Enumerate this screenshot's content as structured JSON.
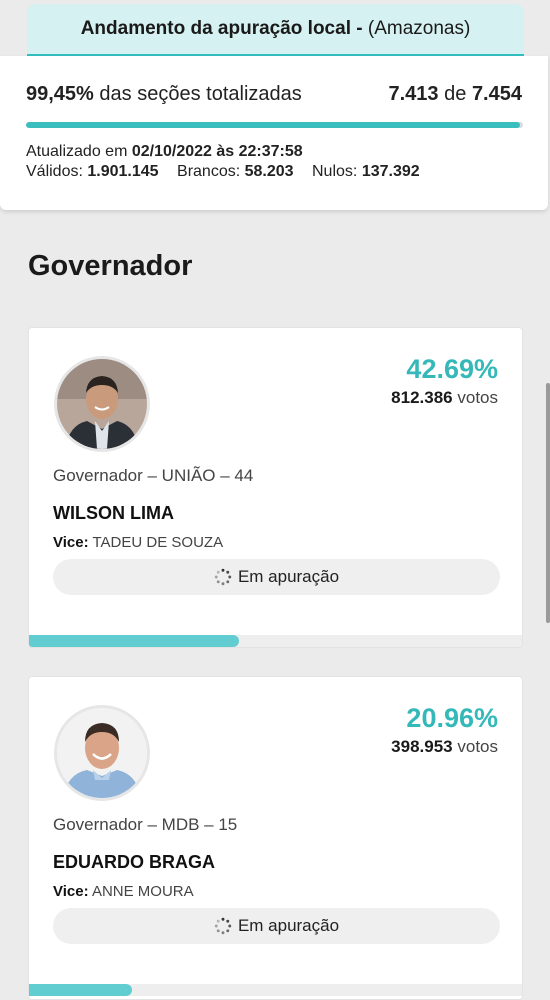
{
  "header": {
    "title": "Andamento da apuração local -",
    "region": "(Amazonas)"
  },
  "status": {
    "percent_sections": "99,45%",
    "sections_label": "das seções totalizadas",
    "sections_done": "7.413",
    "sections_of": "de",
    "sections_total": "7.454",
    "progress_fraction": 0.9945,
    "updated_label": "Atualizado em",
    "updated_value": "02/10/2022 às 22:37:58",
    "valid_label": "Válidos:",
    "valid_value": "1.901.145",
    "blank_label": "Brancos:",
    "blank_value": "58.203",
    "null_label": "Nulos:",
    "null_value": "137.392"
  },
  "section": {
    "title": "Governador"
  },
  "candidates": [
    {
      "percent": "42.69%",
      "percent_fraction": 0.4269,
      "votes": "812.386",
      "votes_label": "votos",
      "party_line": "Governador – UNIÃO – 44",
      "name": "WILSON LIMA",
      "vice_label": "Vice:",
      "vice_name": "TADEU DE SOUZA",
      "status": "Em apuração"
    },
    {
      "percent": "20.96%",
      "percent_fraction": 0.2096,
      "votes": "398.953",
      "votes_label": "votos",
      "party_line": "Governador – MDB – 15",
      "name": "EDUARDO BRAGA",
      "vice_label": "Vice:",
      "vice_name": "ANNE MOURA",
      "status": "Em apuração"
    }
  ],
  "colors": {
    "accent": "#35b9b8",
    "header_bg": "#d6f1f1",
    "bar_fill": "#62cdd1"
  }
}
